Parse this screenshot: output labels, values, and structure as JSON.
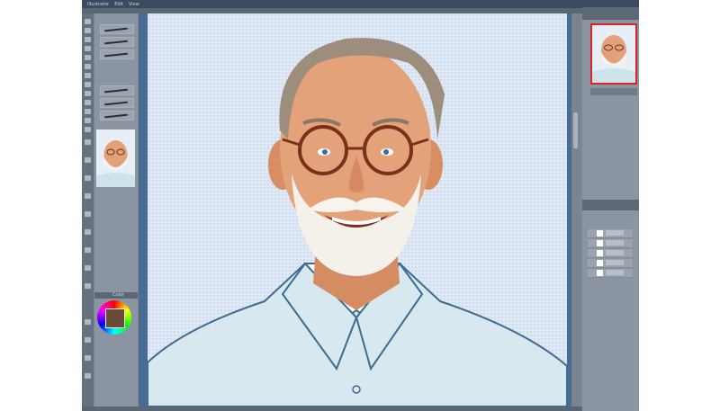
{
  "window": {
    "menu": [
      "Illustrator",
      "Edit",
      "View"
    ],
    "panel_colors": {
      "chrome": "#7d8794",
      "menubar": "#3b4a5e",
      "canvas_bg": "#dfe9f5",
      "highlight": "#d82525"
    }
  },
  "left_panel": {
    "color_title": "Color"
  },
  "icons": {
    "tools": [
      "brush-tool-icon",
      "eraser-icon",
      "move-icon",
      "zoom-icon",
      "eyedropper-icon",
      "fill-icon"
    ]
  }
}
